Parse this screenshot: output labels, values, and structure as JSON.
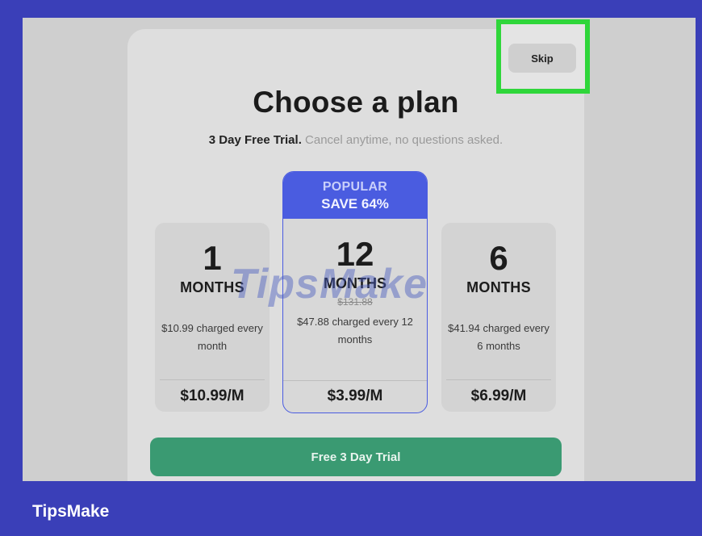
{
  "header": {
    "skip_label": "Skip",
    "title": "Choose a plan",
    "subtitle_bold": "3 Day Free Trial.",
    "subtitle_rest": " Cancel anytime, no questions asked."
  },
  "plans": [
    {
      "number": "1",
      "unit": "MONTHS",
      "description": "$10.99 charged every month",
      "price": "$10.99/M"
    },
    {
      "badge_line1": "POPULAR",
      "badge_line2": "SAVE 64%",
      "number": "12",
      "unit": "MONTHS",
      "original_price": "$131.88",
      "description": "$47.88 charged every 12 months",
      "price": "$3.99/M"
    },
    {
      "number": "6",
      "unit": "MONTHS",
      "description": "$41.94 charged every 6 months",
      "price": "$6.99/M"
    }
  ],
  "cta_label": "Free 3 Day Trial",
  "watermark": "TipsMake",
  "brand": "TipsMake",
  "colors": {
    "frame": "#3a3fb8",
    "highlight": "#2fd63a",
    "accent": "#4a5ce0",
    "cta": "#3a9a72"
  }
}
